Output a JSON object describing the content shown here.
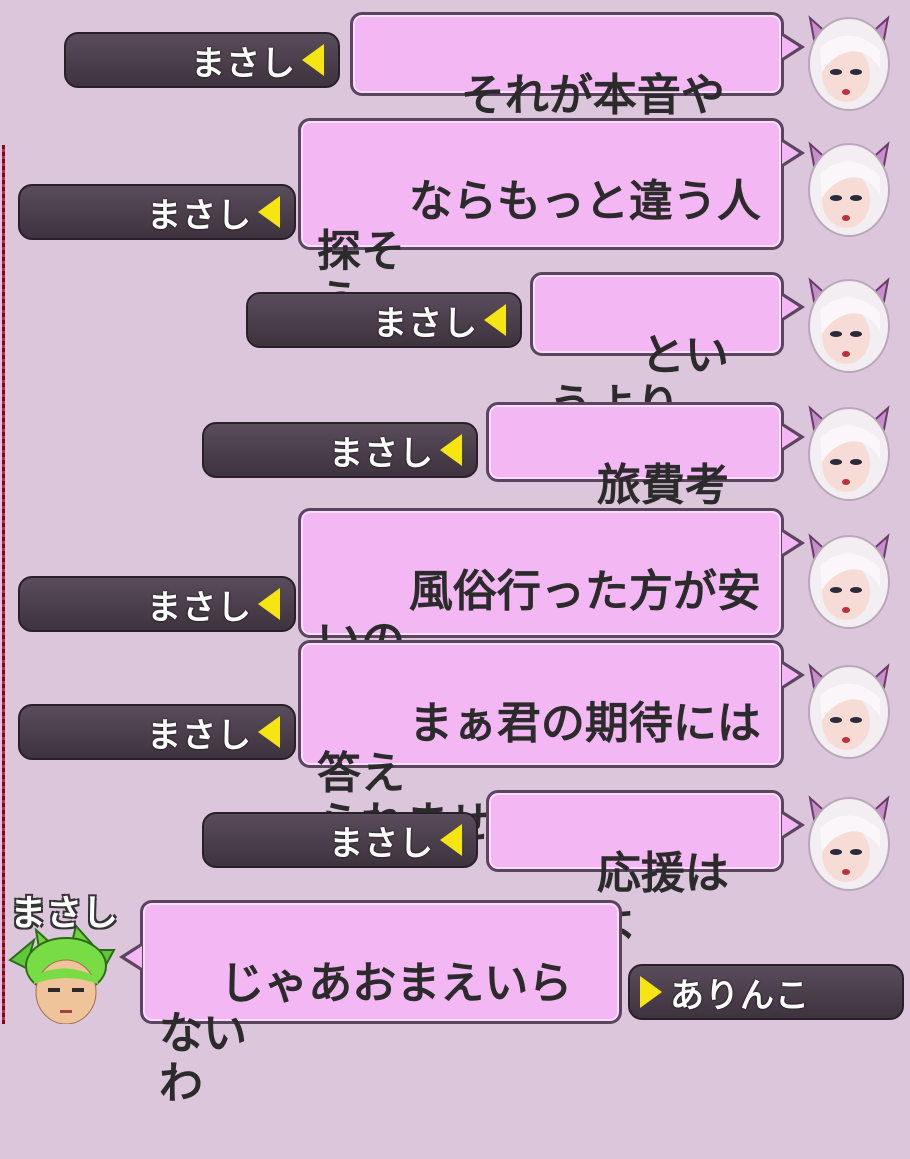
{
  "colors": {
    "background": "#dcc6dc",
    "bubble": "#f3b8f3",
    "bubble_border": "#5a4460",
    "namebar": "#4a3e4a",
    "marker": "#f5e612"
  },
  "messages": [
    {
      "sender": "まさし",
      "text": "それが本音やんけっ"
    },
    {
      "sender": "まさし",
      "text": "ならもっと違う人探そ\nう"
    },
    {
      "sender": "まさし",
      "text": "というより"
    },
    {
      "sender": "まさし",
      "text": "旅費考えたら"
    },
    {
      "sender": "まさし",
      "text": "風俗行った方が安いの\nでは？？"
    },
    {
      "sender": "まさし",
      "text": "まぁ君の期待には答え\nられませんが"
    },
    {
      "sender": "まさし",
      "text": "応援はするよ"
    }
  ],
  "last_message": {
    "speaker_label": "まさし",
    "text": "じゃあおまえいらない\nわ",
    "recipient": "ありんこ"
  },
  "icons": {
    "cat_avatar": "cat-eared-girl-avatar-icon",
    "elf_avatar": "green-hair-elf-avatar-icon",
    "marker": "yellow-triangle-icon"
  }
}
